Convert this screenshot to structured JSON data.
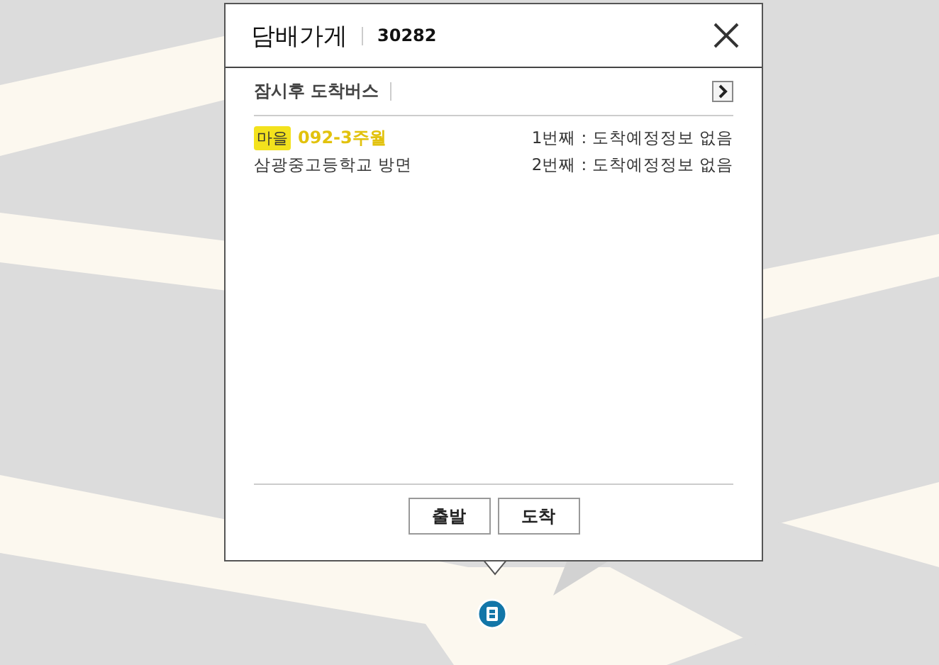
{
  "popup": {
    "title": "담배가게",
    "stop_number": "30282",
    "section_title": "잠시후 도착버스",
    "buses": [
      {
        "type_label": "마을",
        "route": "092-3주월",
        "direction": "삼광중고등학교 방면",
        "arrivals": [
          "1번째 : 도착예정정보 없음",
          "2번째 : 도착예정정보 없음"
        ]
      }
    ],
    "buttons": [
      "출발",
      "도착"
    ]
  }
}
